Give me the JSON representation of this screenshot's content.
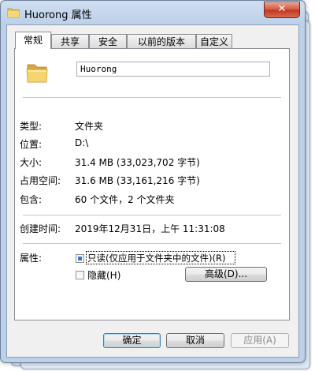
{
  "window": {
    "title": "Huorong 属性",
    "close_label": "✕"
  },
  "tabs": [
    {
      "label": "常规",
      "active": true
    },
    {
      "label": "共享",
      "active": false
    },
    {
      "label": "安全",
      "active": false
    },
    {
      "label": "以前的版本",
      "active": false
    },
    {
      "label": "自定义",
      "active": false
    }
  ],
  "general": {
    "folder_name": "Huorong",
    "folder_icon": "folder-icon",
    "type_label": "类型:",
    "type_value": "文件夹",
    "location_label": "位置:",
    "location_value": "D:\\",
    "size_label": "大小:",
    "size_value": "31.4 MB (33,023,702 字节)",
    "disk_label": "占用空间:",
    "disk_value": "31.6 MB (33,161,216 字节)",
    "contains_label": "包含:",
    "contains_value": "60 个文件，2 个文件夹",
    "created_label": "创建时间:",
    "created_value": "2019年12月31日，上午 11:31:08",
    "attributes_label": "属性:",
    "readonly_label": "只读(仅应用于文件夹中的文件)(R)",
    "readonly_state": "indeterminate",
    "hidden_label": "隐藏(H)",
    "hidden_state": "unchecked",
    "advanced_label": "高级(D)..."
  },
  "footer": {
    "ok_label": "确定",
    "cancel_label": "取消",
    "apply_label": "应用(A)"
  },
  "colors": {
    "titlebar": "#bcd0e8",
    "close_button": "#c2361f",
    "checkbox_fill": "#3b79c3"
  }
}
